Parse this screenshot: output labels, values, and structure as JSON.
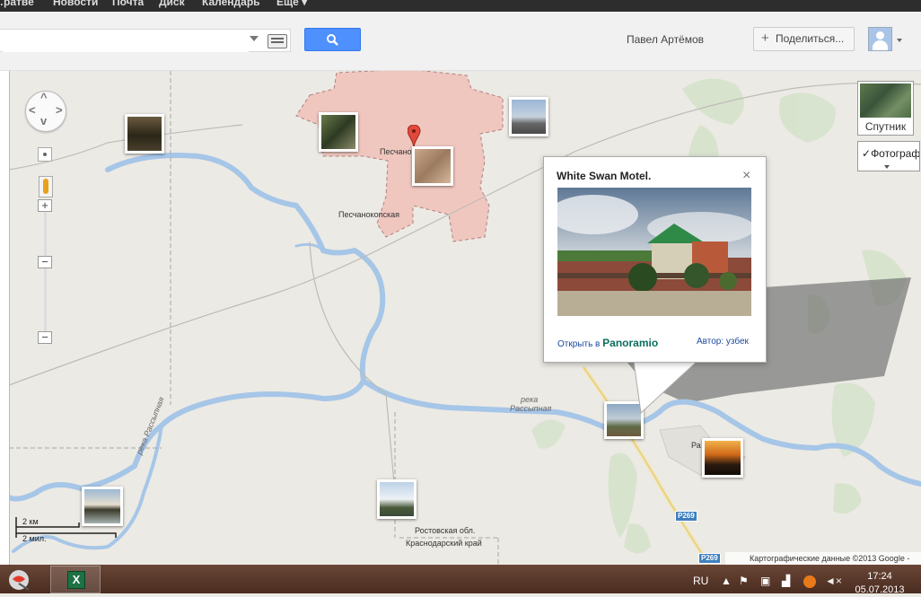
{
  "topbar": {
    "items": [
      "…ратве",
      "Новости",
      "Почта",
      "Диск",
      "Календарь",
      "Ещё ▾"
    ]
  },
  "header": {
    "search_value": "",
    "username": "Павел Артёмов",
    "share_label": "Поделиться..."
  },
  "map": {
    "labels": {
      "town_short": "Песчано",
      "town_full": "Песчанокопская",
      "river_word": "река",
      "river_name": "Рассыпная",
      "river_left": "река Рассыпная",
      "region1": "Ростовская обл.",
      "region2": "Краснодарский край",
      "village_partial": "Ра"
    },
    "roads": [
      "Р269",
      "Р269"
    ],
    "scale": {
      "km": "2 км",
      "mi": "2 мил."
    },
    "copyright": "Картографические данные ©2013 Google -",
    "satellite_label": "Спутник",
    "photos_label": "Фотографии"
  },
  "popup": {
    "title": "White Swan Motel.",
    "close": "×",
    "open_prefix": "Открыть в",
    "open_brand": "Panoramio",
    "author": "Автор: узбек"
  },
  "colors": {
    "river": "#a6c6e8",
    "town_fill": "#f0c7bf",
    "search_button": "#4d90fe",
    "land": "#eceae4"
  },
  "taskbar": {
    "lang": "RU",
    "time": "17:24",
    "date": "05.07.2013"
  }
}
